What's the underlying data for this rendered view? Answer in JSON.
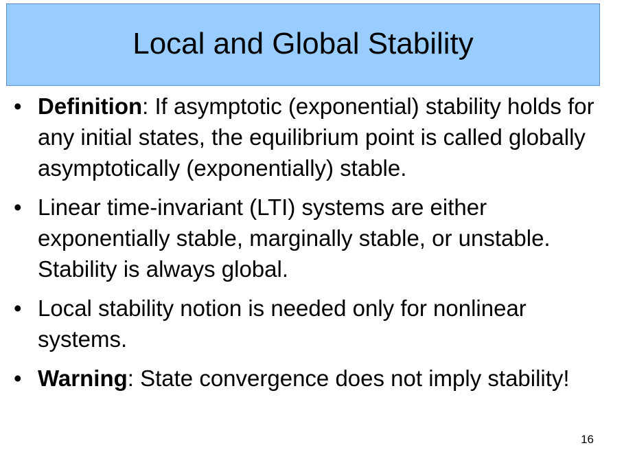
{
  "slide": {
    "title": "Local and Global Stability",
    "page_number": "16"
  },
  "bullets": [
    {
      "term": "Definition",
      "text": ": If asymptotic (exponential) stability holds for any initial states, the equilibrium point is called globally asymptotically (exponentially) stable."
    },
    {
      "term": "",
      "text": "Linear time-invariant (LTI) systems are either exponentially stable, marginally stable, or unstable. Stability is always global."
    },
    {
      "term": "",
      "text": "Local stability notion is needed only for nonlinear systems."
    },
    {
      "term": "Warning",
      "text": ": State convergence does not imply stability!"
    }
  ],
  "colors": {
    "title_background": "#99ccff",
    "title_border": "#5b8fd0"
  }
}
